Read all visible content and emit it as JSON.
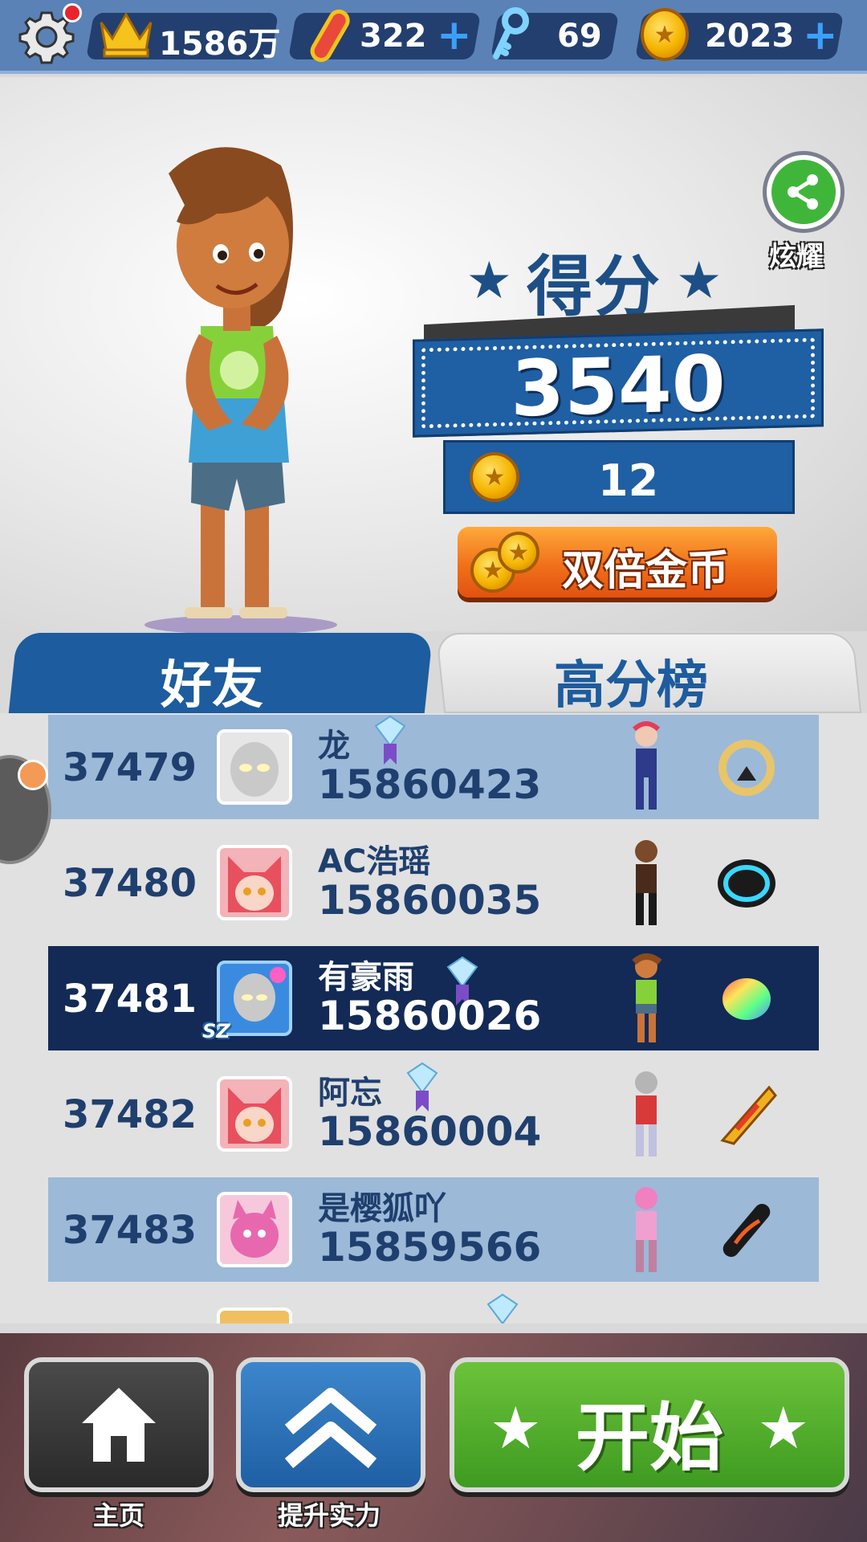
{
  "topbar": {
    "crown_value": "1586万",
    "boards_value": "322",
    "keys_value": "69",
    "coins_value": "2023",
    "plus_symbol": "+"
  },
  "share": {
    "label": "炫耀"
  },
  "score": {
    "title": "得分",
    "value": "3540",
    "coins_earned": "12",
    "double_button": "双倍金币"
  },
  "tabs": {
    "friends": "好友",
    "high_scores": "高分榜"
  },
  "leaderboard": [
    {
      "rank": "37479",
      "name": "龙",
      "score": "15860423",
      "style": "light",
      "diamond": true,
      "diamond_color": "#7b4cc7"
    },
    {
      "rank": "37480",
      "name": "AC浩瑶",
      "score": "15860035",
      "style": "plain",
      "diamond": false
    },
    {
      "rank": "37481",
      "name": "有豪雨",
      "score": "15860026",
      "style": "dark",
      "diamond": true,
      "diamond_color": "#7b4cc7",
      "avatar_badge": "SZ"
    },
    {
      "rank": "37482",
      "name": "阿忘",
      "score": "15860004",
      "style": "plain",
      "diamond": true,
      "diamond_color": "#7b4cc7"
    },
    {
      "rank": "37483",
      "name": "是樱狐吖",
      "score": "15859566",
      "style": "light",
      "diamond": false
    },
    {
      "rank": "",
      "name": "",
      "score": "",
      "style": "plain",
      "diamond": true,
      "diamond_color": "#7b4cc7"
    }
  ],
  "bottom": {
    "home_label": "主页",
    "upgrade_label": "提升实力",
    "start_label": "开始"
  },
  "colors": {
    "accent_blue": "#1f5fa3",
    "start_green": "#3e9b21",
    "orange": "#f0701a"
  }
}
